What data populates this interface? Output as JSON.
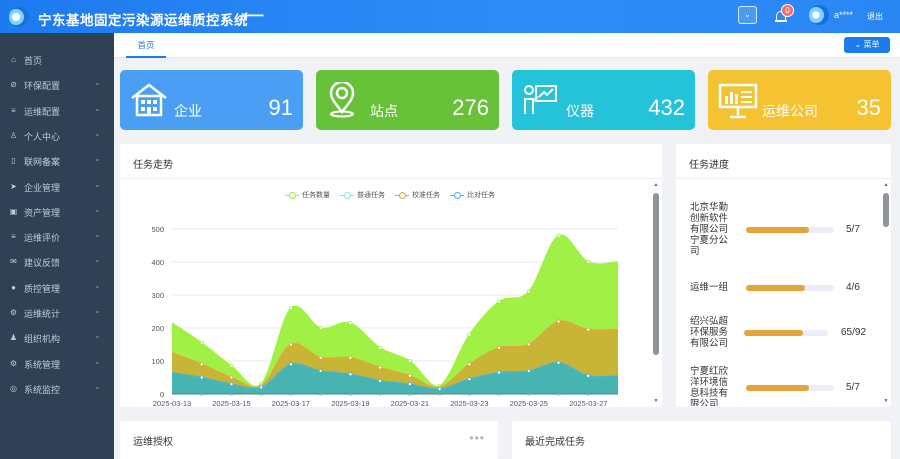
{
  "header": {
    "title": "宁东基地固定污染源运维质控系统",
    "back": "⟵",
    "notif_count": "0",
    "username": "a****",
    "logout": "退出"
  },
  "sidebar": {
    "items": [
      {
        "label": "首页",
        "icon": "home-icon",
        "glyph": "⌂",
        "chevron": false
      },
      {
        "label": "环保配置",
        "icon": "leaf-icon",
        "glyph": "⊘",
        "chevron": true
      },
      {
        "label": "运维配置",
        "icon": "list-icon",
        "glyph": "≡",
        "chevron": true
      },
      {
        "label": "个人中心",
        "icon": "user-icon",
        "glyph": "♙",
        "chevron": true
      },
      {
        "label": "联网备案",
        "icon": "file-icon",
        "glyph": "▯",
        "chevron": true
      },
      {
        "label": "企业管理",
        "icon": "send-icon",
        "glyph": "➤",
        "chevron": true
      },
      {
        "label": "资产管理",
        "icon": "asset-icon",
        "glyph": "▣",
        "chevron": true
      },
      {
        "label": "运维评价",
        "icon": "list-icon",
        "glyph": "≡",
        "chevron": true
      },
      {
        "label": "建议反馈",
        "icon": "mail-icon",
        "glyph": "✉",
        "chevron": true
      },
      {
        "label": "质控管理",
        "icon": "check-icon",
        "glyph": "●",
        "chevron": true
      },
      {
        "label": "运维统计",
        "icon": "gear-icon",
        "glyph": "⚙",
        "chevron": true
      },
      {
        "label": "组织机构",
        "icon": "org-icon",
        "glyph": "♟",
        "chevron": true
      },
      {
        "label": "系统管理",
        "icon": "cogs-icon",
        "glyph": "⚙",
        "chevron": true
      },
      {
        "label": "系统监控",
        "icon": "monitor-icon",
        "glyph": "◎",
        "chevron": true
      }
    ]
  },
  "tabs": {
    "home": "首页",
    "menu": "⌄ 菜单"
  },
  "stats": [
    {
      "label": "企业",
      "value": "91",
      "color": "#4a9ff5"
    },
    {
      "label": "站点",
      "value": "276",
      "color": "#67c23a"
    },
    {
      "label": "仪器",
      "value": "432",
      "color": "#25c3d9"
    },
    {
      "label": "运维公司",
      "value": "35",
      "color": "#f5c332"
    }
  ],
  "panels": {
    "trend_title": "任务走势",
    "progress_title": "任务进度",
    "auth_title": "运维授权",
    "recent_title": "最近完成任务",
    "more": "•••"
  },
  "chart_data": {
    "type": "area",
    "categories": [
      "2025-03-13",
      "2025-03-14",
      "2025-03-15",
      "2025-03-16",
      "2025-03-17",
      "2025-03-18",
      "2025-03-19",
      "2025-03-20",
      "2025-03-21",
      "2025-03-22",
      "2025-03-23",
      "2025-03-24",
      "2025-03-25",
      "2025-03-26",
      "2025-03-27",
      "2025-03-28"
    ],
    "xtick_labels": [
      "2025-03-13",
      "2025-03-15",
      "2025-03-17",
      "2025-03-19",
      "2025-03-21",
      "2025-03-23",
      "2025-03-25",
      "2025-03-27"
    ],
    "ylim": [
      0,
      500
    ],
    "yticks": [
      "0",
      "100",
      "200",
      "300",
      "400",
      "500"
    ],
    "stacked": true,
    "series": [
      {
        "name": "任务数量",
        "color": "#9ef23c",
        "values": [
          215,
          155,
          85,
          30,
          260,
          200,
          215,
          140,
          100,
          25,
          180,
          280,
          310,
          480,
          400,
          400
        ]
      },
      {
        "name": "普通任务",
        "color": "#8ce8e0",
        "values": [
          0,
          0,
          0,
          0,
          0,
          0,
          0,
          0,
          0,
          0,
          0,
          0,
          0,
          0,
          0,
          0
        ]
      },
      {
        "name": "校准任务",
        "color": "#e6a23c",
        "values": [
          125,
          90,
          50,
          25,
          150,
          110,
          110,
          80,
          55,
          20,
          90,
          140,
          150,
          220,
          195,
          195
        ]
      },
      {
        "name": "比对任务",
        "color": "#3fb6d6",
        "values": [
          65,
          50,
          30,
          20,
          90,
          70,
          60,
          40,
          30,
          15,
          45,
          65,
          70,
          95,
          55,
          55
        ]
      }
    ]
  },
  "progress": [
    {
      "name": "北京华勤创新软件有限公司宁夏分公司",
      "value": "5/7",
      "ratio": 0.714
    },
    {
      "name": "运维一组",
      "value": "4/6",
      "ratio": 0.667
    },
    {
      "name": "绍兴弘超环保服务有限公司",
      "value": "65/92",
      "ratio": 0.707
    },
    {
      "name": "宁夏红欣洋环境信息科技有限公司",
      "value": "5/7",
      "ratio": 0.714
    }
  ]
}
